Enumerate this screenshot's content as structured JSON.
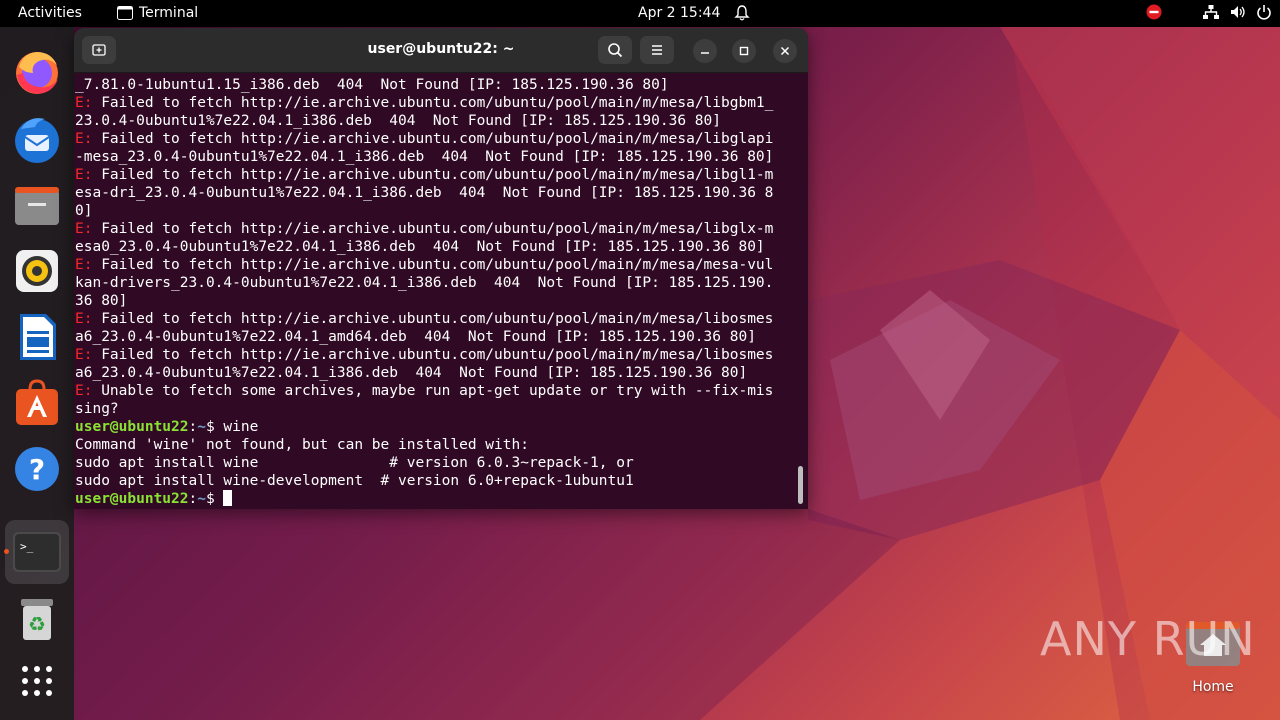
{
  "topbar": {
    "activities": "Activities",
    "app_name": "Terminal",
    "clock": "Apr 2  15:44"
  },
  "dock": {
    "items": [
      "Firefox",
      "Thunderbird",
      "Files",
      "Rhythmbox",
      "LibreOffice Writer",
      "Ubuntu Software",
      "Help",
      "Terminal",
      "Trash",
      "Show Applications"
    ]
  },
  "terminal": {
    "title": "user@ubuntu22: ~",
    "lines": [
      {
        "type": "plain",
        "text": "_7.81.0-1ubuntu1.15_i386.deb  404  Not Found [IP: 185.125.190.36 80]"
      },
      {
        "type": "err",
        "prefix": "E:",
        "text": " Failed to fetch http://ie.archive.ubuntu.com/ubuntu/pool/main/m/mesa/libgbm1_"
      },
      {
        "type": "plain",
        "text": "23.0.4-0ubuntu1%7e22.04.1_i386.deb  404  Not Found [IP: 185.125.190.36 80]"
      },
      {
        "type": "err",
        "prefix": "E:",
        "text": " Failed to fetch http://ie.archive.ubuntu.com/ubuntu/pool/main/m/mesa/libglapi"
      },
      {
        "type": "plain",
        "text": "-mesa_23.0.4-0ubuntu1%7e22.04.1_i386.deb  404  Not Found [IP: 185.125.190.36 80]"
      },
      {
        "type": "err",
        "prefix": "E:",
        "text": " Failed to fetch http://ie.archive.ubuntu.com/ubuntu/pool/main/m/mesa/libgl1-m"
      },
      {
        "type": "plain",
        "text": "esa-dri_23.0.4-0ubuntu1%7e22.04.1_i386.deb  404  Not Found [IP: 185.125.190.36 8"
      },
      {
        "type": "plain",
        "text": "0]"
      },
      {
        "type": "err",
        "prefix": "E:",
        "text": " Failed to fetch http://ie.archive.ubuntu.com/ubuntu/pool/main/m/mesa/libglx-m"
      },
      {
        "type": "plain",
        "text": "esa0_23.0.4-0ubuntu1%7e22.04.1_i386.deb  404  Not Found [IP: 185.125.190.36 80]"
      },
      {
        "type": "err",
        "prefix": "E:",
        "text": " Failed to fetch http://ie.archive.ubuntu.com/ubuntu/pool/main/m/mesa/mesa-vul"
      },
      {
        "type": "plain",
        "text": "kan-drivers_23.0.4-0ubuntu1%7e22.04.1_i386.deb  404  Not Found [IP: 185.125.190."
      },
      {
        "type": "plain",
        "text": "36 80]"
      },
      {
        "type": "err",
        "prefix": "E:",
        "text": " Failed to fetch http://ie.archive.ubuntu.com/ubuntu/pool/main/m/mesa/libosmes"
      },
      {
        "type": "plain",
        "text": "a6_23.0.4-0ubuntu1%7e22.04.1_amd64.deb  404  Not Found [IP: 185.125.190.36 80]"
      },
      {
        "type": "err",
        "prefix": "E:",
        "text": " Failed to fetch http://ie.archive.ubuntu.com/ubuntu/pool/main/m/mesa/libosmes"
      },
      {
        "type": "plain",
        "text": "a6_23.0.4-0ubuntu1%7e22.04.1_i386.deb  404  Not Found [IP: 185.125.190.36 80]"
      },
      {
        "type": "err",
        "prefix": "E:",
        "text": " Unable to fetch some archives, maybe run apt-get update or try with --fix-mis"
      },
      {
        "type": "plain",
        "text": "sing?"
      },
      {
        "type": "prompt",
        "user": "user@ubuntu22",
        "path": "~",
        "text": "$ wine"
      },
      {
        "type": "plain",
        "text": "Command 'wine' not found, but can be installed with:"
      },
      {
        "type": "plain",
        "text": "sudo apt install wine               # version 6.0.3~repack-1, or"
      },
      {
        "type": "plain",
        "text": "sudo apt install wine-development  # version 6.0+repack-1ubuntu1"
      },
      {
        "type": "prompt",
        "user": "user@ubuntu22",
        "path": "~",
        "text": "$ "
      }
    ]
  },
  "desktop": {
    "home_label": "Home",
    "watermark": "ANY RUN"
  },
  "colors": {
    "terminal_bg": "#300a24",
    "error": "#ef2929",
    "prompt_user": "#8ae234",
    "prompt_path": "#729fcf",
    "accent": "#e95420"
  }
}
